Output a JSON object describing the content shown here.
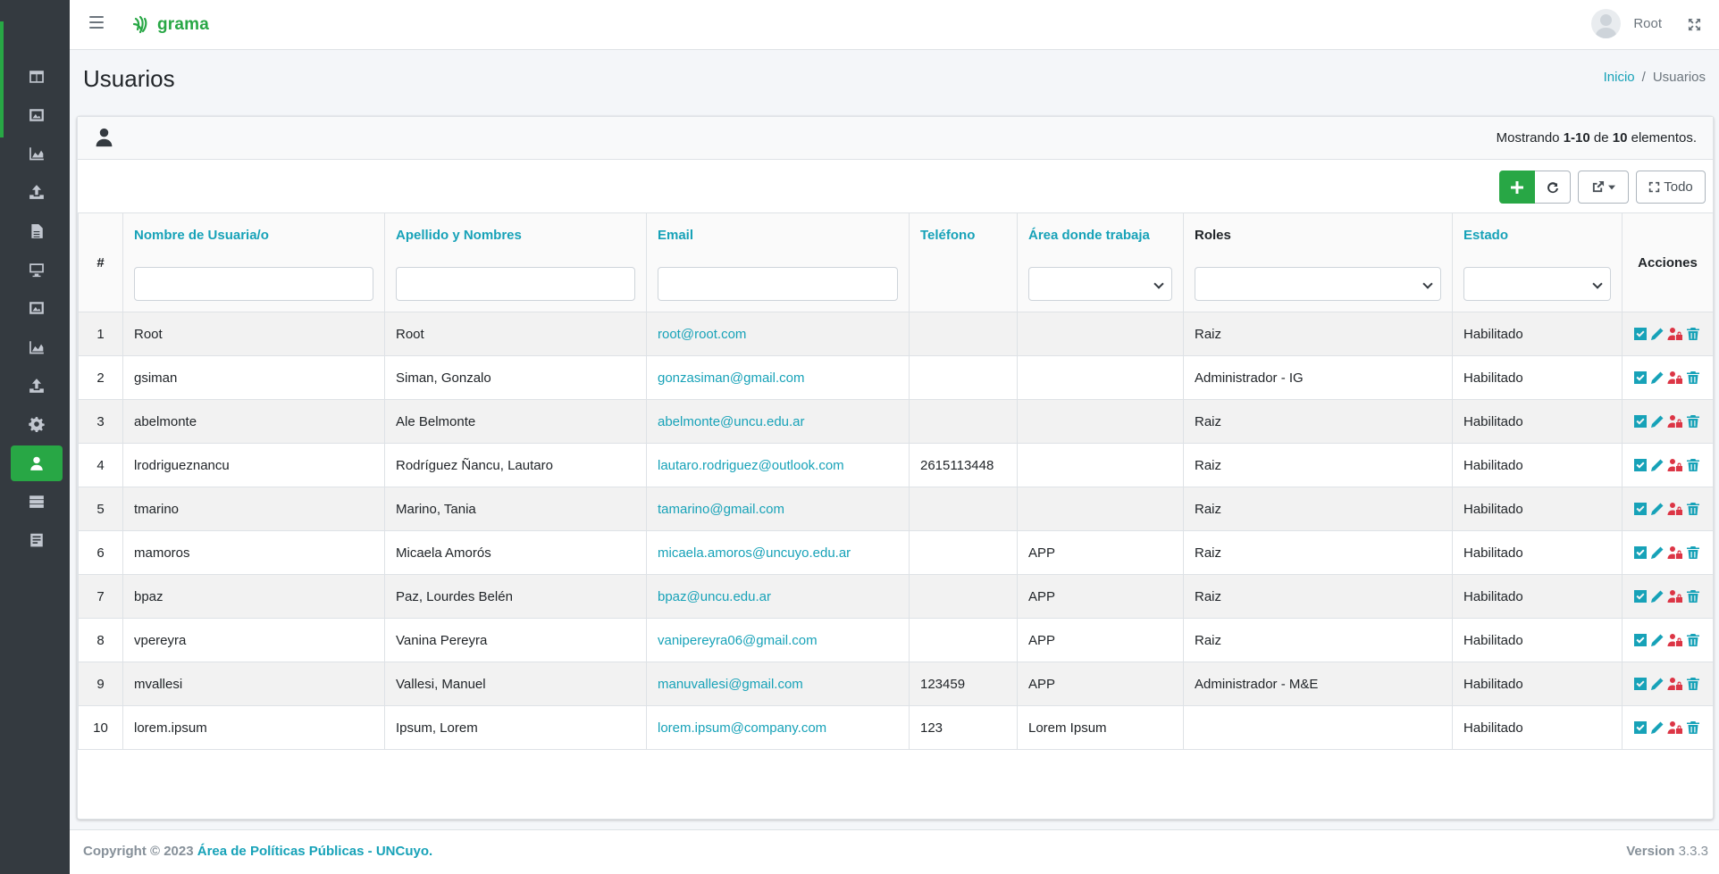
{
  "brand": {
    "name": "grama"
  },
  "header": {
    "user_name": "Root"
  },
  "page": {
    "title": "Usuarios",
    "breadcrumb": {
      "home": "Inicio",
      "separator": "/",
      "current": "Usuarios"
    }
  },
  "summary": {
    "prefix": "Mostrando ",
    "range": "1-10",
    "middle": " de ",
    "total": "10",
    "suffix": " elementos."
  },
  "toolbar": {
    "all_label": "Todo"
  },
  "table": {
    "columns": {
      "index": "#",
      "username": "Nombre de Usuaria/o",
      "fullname": "Apellido y Nombres",
      "email": "Email",
      "phone": "Teléfono",
      "area": "Área donde trabaja",
      "roles": "Roles",
      "status": "Estado",
      "actions": "Acciones"
    },
    "rows": [
      {
        "n": "1",
        "user": "Root",
        "name": "Root",
        "email": "root@root.com",
        "phone": "",
        "area": "",
        "role": "Raiz",
        "status": "Habilitado"
      },
      {
        "n": "2",
        "user": "gsiman",
        "name": "Siman, Gonzalo",
        "email": "gonzasiman@gmail.com",
        "phone": "",
        "area": "",
        "role": "Administrador - IG",
        "status": "Habilitado"
      },
      {
        "n": "3",
        "user": "abelmonte",
        "name": "Ale Belmonte",
        "email": "abelmonte@uncu.edu.ar",
        "phone": "",
        "area": "",
        "role": "Raiz",
        "status": "Habilitado"
      },
      {
        "n": "4",
        "user": "lrodrigueznancu",
        "name": "Rodríguez Ñancu, Lautaro",
        "email": "lautaro.rodriguez@outlook.com",
        "phone": "2615113448",
        "area": "",
        "role": "Raiz",
        "status": "Habilitado"
      },
      {
        "n": "5",
        "user": "tmarino",
        "name": "Marino, Tania",
        "email": "tamarino@gmail.com",
        "phone": "",
        "area": "",
        "role": "Raiz",
        "status": "Habilitado"
      },
      {
        "n": "6",
        "user": "mamoros",
        "name": "Micaela Amorós",
        "email": "micaela.amoros@uncuyo.edu.ar",
        "phone": "",
        "area": "APP",
        "role": "Raiz",
        "status": "Habilitado"
      },
      {
        "n": "7",
        "user": "bpaz",
        "name": "Paz, Lourdes Belén",
        "email": "bpaz@uncu.edu.ar",
        "phone": "",
        "area": "APP",
        "role": "Raiz",
        "status": "Habilitado"
      },
      {
        "n": "8",
        "user": "vpereyra",
        "name": "Vanina Pereyra",
        "email": "vanipereyra06@gmail.com",
        "phone": "",
        "area": "APP",
        "role": "Raiz",
        "status": "Habilitado"
      },
      {
        "n": "9",
        "user": "mvallesi",
        "name": "Vallesi, Manuel",
        "email": "manuvallesi@gmail.com",
        "phone": "123459",
        "area": "APP",
        "role": "Administrador - M&E",
        "status": "Habilitado"
      },
      {
        "n": "10",
        "user": "lorem.ipsum",
        "name": "Ipsum, Lorem",
        "email": "lorem.ipsum@company.com",
        "phone": "123",
        "area": "Lorem Ipsum",
        "role": "",
        "status": "Habilitado"
      }
    ]
  },
  "footer": {
    "copyright": "Copyright © 2023 ",
    "org": "Área de Políticas Públicas - UNCuyo",
    "dot": ".",
    "version_label": "Version",
    "version": "3.3.3"
  },
  "icons": {
    "sidebar": [
      "table-icon",
      "image-icon",
      "chart-area-icon",
      "upload-icon",
      "file-icon",
      "desktop-icon",
      "image-icon",
      "chart-area-icon",
      "upload-icon",
      "gear-icon",
      "user-icon",
      "server-icon",
      "form-icon"
    ],
    "actions": [
      "check-square-icon",
      "pencil-icon",
      "user-lock-icon",
      "trash-icon"
    ]
  },
  "colors": {
    "accent": "#28a745",
    "link": "#17a2b8",
    "sidebar": "#343a40",
    "danger": "#dc3545"
  }
}
